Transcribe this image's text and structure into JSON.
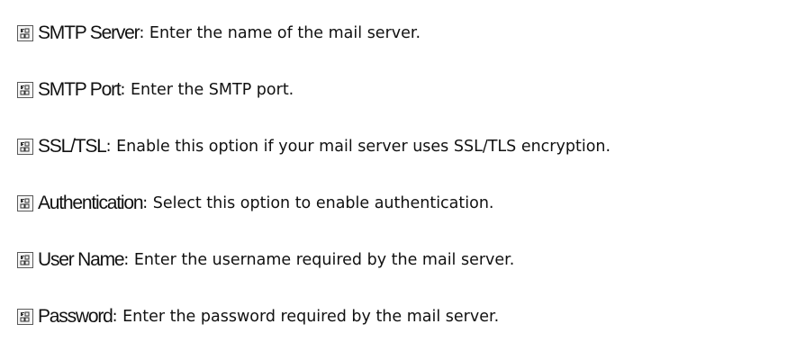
{
  "items": [
    {
      "term": "SMTP Server",
      "description": ": Enter the name of the mail server.",
      "icon": "document-icon"
    },
    {
      "term": "SMTP Port",
      "description": ": Enter the SMTP port.",
      "icon": "document-icon"
    },
    {
      "term": "SSL/TSL",
      "description": ": Enable this option if your mail server uses SSL/TLS encryption.",
      "icon": "document-icon"
    },
    {
      "term": "Authentication",
      "description": ": Select this option to enable authentication.",
      "icon": "document-icon"
    },
    {
      "term": "User Name",
      "description": ": Enter the username required by the mail server.",
      "icon": "document-icon"
    },
    {
      "term": "Password",
      "description": ": Enter the password required by the mail server.",
      "icon": "document-icon"
    }
  ]
}
